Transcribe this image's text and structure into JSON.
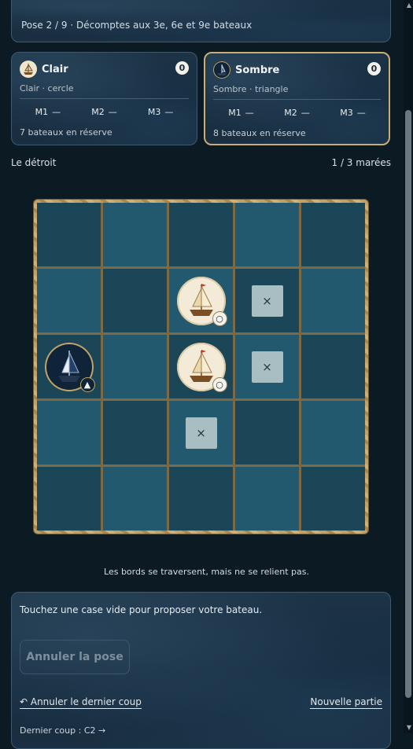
{
  "header": {
    "status": "Pose 2 / 9 · Décomptes aux 3e, 6e et 9e bateaux"
  },
  "players": {
    "light": {
      "name": "Clair",
      "score": "0",
      "subtitle": "Clair · cercle",
      "marks": [
        {
          "label": "M1",
          "value": "—"
        },
        {
          "label": "M2",
          "value": "—"
        },
        {
          "label": "M3",
          "value": "—"
        }
      ],
      "reserve": "7 bateaux en réserve"
    },
    "dark": {
      "name": "Sombre",
      "score": "0",
      "subtitle": "Sombre · triangle",
      "marks": [
        {
          "label": "M1",
          "value": "—"
        },
        {
          "label": "M2",
          "value": "—"
        },
        {
          "label": "M3",
          "value": "—"
        }
      ],
      "reserve": "8 bateaux en réserve"
    }
  },
  "board": {
    "label": "Le détroit",
    "tides": "1 / 3 marées",
    "size": 5,
    "cells": [
      [
        "dark",
        "light",
        "dark",
        "light",
        "dark"
      ],
      [
        "light",
        "dark",
        "light",
        "dark",
        "light"
      ],
      [
        "dark",
        "light",
        "dark",
        "light",
        "dark"
      ],
      [
        "light",
        "dark",
        "light",
        "dark",
        "light"
      ],
      [
        "dark",
        "light",
        "dark",
        "light",
        "dark"
      ]
    ],
    "pieces": [
      {
        "row": 1,
        "col": 2,
        "type": "boat",
        "owner": "light",
        "badge": "○"
      },
      {
        "row": 2,
        "col": 2,
        "type": "boat",
        "owner": "light",
        "badge": "○"
      },
      {
        "row": 2,
        "col": 0,
        "type": "boat",
        "owner": "dark",
        "badge": "▲"
      },
      {
        "row": 1,
        "col": 3,
        "type": "blocked",
        "symbol": "×"
      },
      {
        "row": 2,
        "col": 3,
        "type": "blocked",
        "symbol": "×"
      },
      {
        "row": 3,
        "col": 2,
        "type": "blocked",
        "symbol": "×"
      }
    ]
  },
  "edge_note": "Les bords se traversent, mais ne se relient pas.",
  "actions": {
    "hint": "Touchez une case vide pour proposer votre bateau.",
    "cancel_pose": "Annuler la pose",
    "undo": "↶ Annuler le dernier coup",
    "new_game": "Nouvelle partie",
    "last_move": "Dernier coup : C2 →"
  },
  "colors": {
    "cell_dark": "#1b4658",
    "cell_light": "#22596f",
    "board_frame": "#bfa16a",
    "accent_gold": "#c9ae74",
    "blocked": "#a9bec2",
    "background": "#0c1a24"
  },
  "icons": {
    "light_avatar": "ship-light-icon",
    "dark_avatar": "ship-dark-icon",
    "blocked_marker": "cross-icon"
  }
}
